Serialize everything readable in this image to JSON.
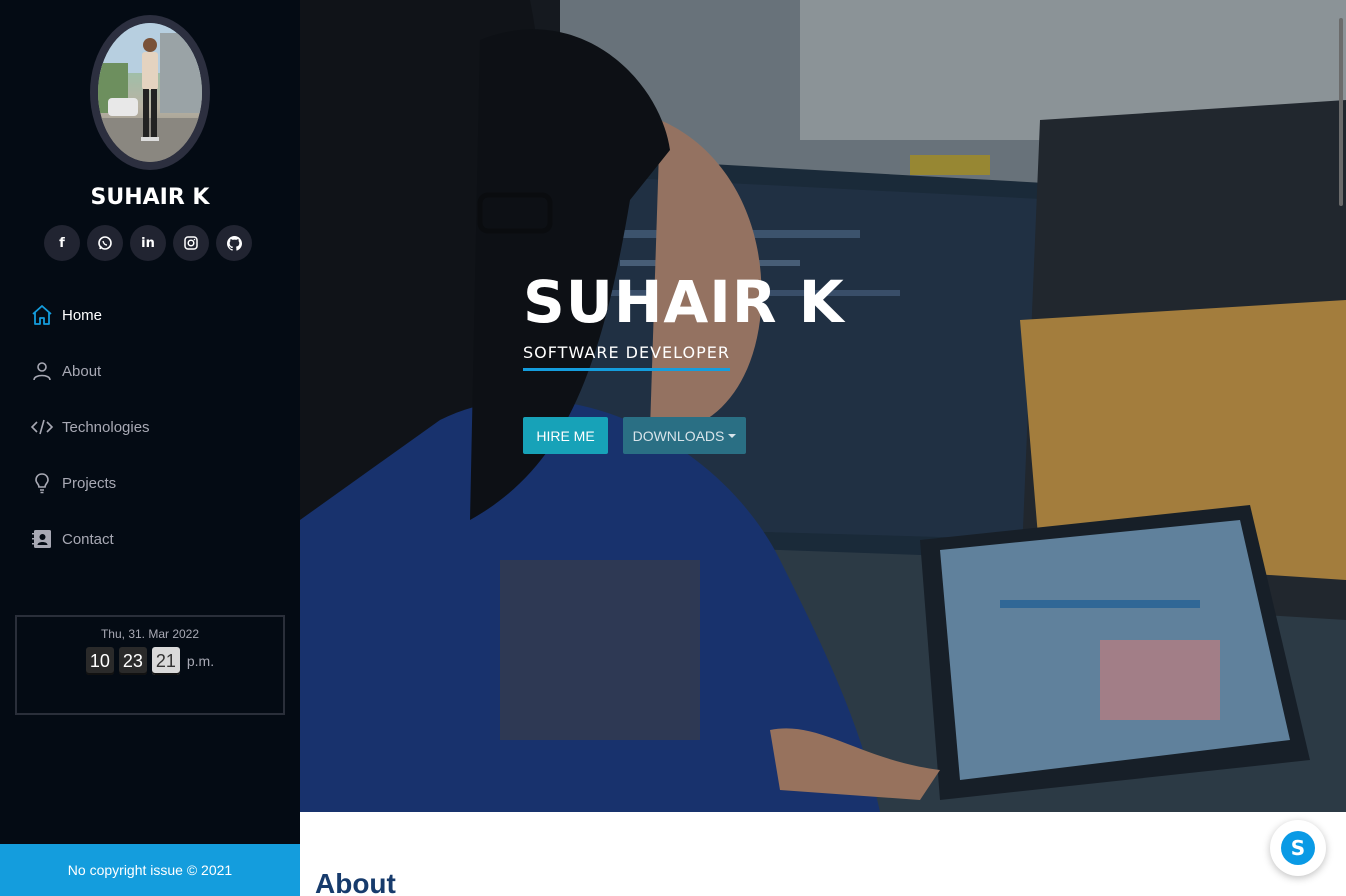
{
  "profile": {
    "name": "SUHAIR K",
    "avatar_alt": "profile photo"
  },
  "social": [
    {
      "icon": "facebook-icon",
      "glyph": "f"
    },
    {
      "icon": "whatsapp-icon",
      "glyph": "✆"
    },
    {
      "icon": "linkedin-icon",
      "glyph": "in"
    },
    {
      "icon": "instagram-icon",
      "glyph": "◎"
    },
    {
      "icon": "github-icon",
      "glyph": "⌘"
    }
  ],
  "nav": {
    "items": [
      {
        "label": "Home",
        "icon": "home-icon",
        "active": true
      },
      {
        "label": "About",
        "icon": "user-icon",
        "active": false
      },
      {
        "label": "Technologies",
        "icon": "code-icon",
        "active": false
      },
      {
        "label": "Projects",
        "icon": "lightbulb-icon",
        "active": false
      },
      {
        "label": "Contact",
        "icon": "contact-card-icon",
        "active": false
      }
    ]
  },
  "clock": {
    "date": "Thu, 31. Mar 2022",
    "hours": "10",
    "minutes": "23",
    "seconds": "21",
    "ampm": "p.m."
  },
  "footer": {
    "copyright": "No copyright issue © 2021"
  },
  "hero": {
    "title": "SUHAIR K",
    "subtitle": "SOFTWARE DEVELOPER",
    "hire_label": "HIRE ME",
    "downloads_label": "DOWNLOADS"
  },
  "about": {
    "heading": "About"
  },
  "colors": {
    "sidebar_bg": "#040b14",
    "accent": "#149ddd",
    "hire_button": "#17a2b8",
    "heading": "#173b6c"
  }
}
